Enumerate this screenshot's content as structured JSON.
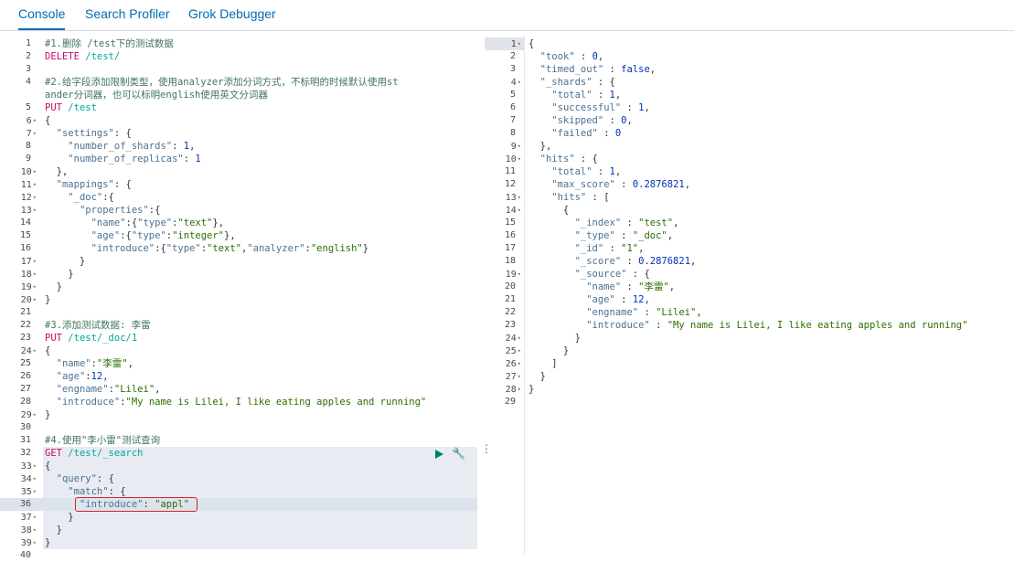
{
  "tabs": [
    {
      "label": "Console",
      "selected": true
    },
    {
      "label": "Search Profiler",
      "selected": false
    },
    {
      "label": "Grok Debugger",
      "selected": false
    }
  ],
  "request_lines": [
    {
      "n": "1",
      "t": [
        [
          "cmt",
          "#1.删除 /test下的测试数据"
        ]
      ]
    },
    {
      "n": "2",
      "t": [
        [
          "mth",
          "DELETE "
        ],
        [
          "url",
          "/test/"
        ]
      ]
    },
    {
      "n": "3",
      "t": []
    },
    {
      "n": "4",
      "t": [
        [
          "cmt",
          "#2.给字段添加限制类型，使用analyzer添加分词方式，不标明的时候默认使用st"
        ]
      ],
      "cont": [
        [
          "cmt",
          "ander分词器，也可以标明english使用英文分词器"
        ]
      ]
    },
    {
      "n": "5",
      "t": [
        [
          "mth",
          "PUT "
        ],
        [
          "url",
          "/test"
        ]
      ]
    },
    {
      "n": "6",
      "f": 1,
      "t": [
        [
          "pn",
          "{"
        ]
      ]
    },
    {
      "n": "7",
      "f": 1,
      "t": [
        [
          "pn",
          "  "
        ],
        [
          "key",
          "\"settings\""
        ],
        [
          "pn",
          ": {"
        ]
      ]
    },
    {
      "n": "8",
      "t": [
        [
          "pn",
          "    "
        ],
        [
          "key",
          "\"number_of_shards\""
        ],
        [
          "pn",
          ": "
        ],
        [
          "num",
          "1"
        ],
        [
          "pn",
          ","
        ]
      ]
    },
    {
      "n": "9",
      "t": [
        [
          "pn",
          "    "
        ],
        [
          "key",
          "\"number_of_replicas\""
        ],
        [
          "pn",
          ": "
        ],
        [
          "num",
          "1"
        ]
      ]
    },
    {
      "n": "10",
      "f": 1,
      "t": [
        [
          "pn",
          "  },"
        ]
      ]
    },
    {
      "n": "11",
      "f": 1,
      "t": [
        [
          "pn",
          "  "
        ],
        [
          "key",
          "\"mappings\""
        ],
        [
          "pn",
          ": {"
        ]
      ]
    },
    {
      "n": "12",
      "f": 1,
      "t": [
        [
          "pn",
          "    "
        ],
        [
          "key",
          "\"_doc\""
        ],
        [
          "pn",
          ":{"
        ]
      ]
    },
    {
      "n": "13",
      "f": 1,
      "t": [
        [
          "pn",
          "      "
        ],
        [
          "key",
          "\"properties\""
        ],
        [
          "pn",
          ":{"
        ]
      ]
    },
    {
      "n": "14",
      "t": [
        [
          "pn",
          "        "
        ],
        [
          "key",
          "\"name\""
        ],
        [
          "pn",
          ":{"
        ],
        [
          "key",
          "\"type\""
        ],
        [
          "pn",
          ":"
        ],
        [
          "str",
          "\"text\""
        ],
        [
          "pn",
          "},"
        ]
      ]
    },
    {
      "n": "15",
      "t": [
        [
          "pn",
          "        "
        ],
        [
          "key",
          "\"age\""
        ],
        [
          "pn",
          ":{"
        ],
        [
          "key",
          "\"type\""
        ],
        [
          "pn",
          ":"
        ],
        [
          "str",
          "\"integer\""
        ],
        [
          "pn",
          "},"
        ]
      ]
    },
    {
      "n": "16",
      "t": [
        [
          "pn",
          "        "
        ],
        [
          "key",
          "\"introduce\""
        ],
        [
          "pn",
          ":{"
        ],
        [
          "key",
          "\"type\""
        ],
        [
          "pn",
          ":"
        ],
        [
          "str",
          "\"text\""
        ],
        [
          "pn",
          ","
        ],
        [
          "key",
          "\"analyzer\""
        ],
        [
          "pn",
          ":"
        ],
        [
          "str",
          "\"english\""
        ],
        [
          "pn",
          "}"
        ]
      ]
    },
    {
      "n": "17",
      "f": 1,
      "t": [
        [
          "pn",
          "      }"
        ]
      ]
    },
    {
      "n": "18",
      "f": 1,
      "t": [
        [
          "pn",
          "    }"
        ]
      ]
    },
    {
      "n": "19",
      "f": 1,
      "t": [
        [
          "pn",
          "  }"
        ]
      ]
    },
    {
      "n": "20",
      "f": 1,
      "t": [
        [
          "pn",
          "}"
        ]
      ]
    },
    {
      "n": "21",
      "t": []
    },
    {
      "n": "22",
      "t": [
        [
          "cmt",
          "#3.添加测试数据: 李雷"
        ]
      ]
    },
    {
      "n": "23",
      "t": [
        [
          "mth",
          "PUT "
        ],
        [
          "url",
          "/test/_doc/1"
        ]
      ]
    },
    {
      "n": "24",
      "f": 1,
      "t": [
        [
          "pn",
          "{"
        ]
      ]
    },
    {
      "n": "25",
      "t": [
        [
          "pn",
          "  "
        ],
        [
          "key",
          "\"name\""
        ],
        [
          "pn",
          ":"
        ],
        [
          "str",
          "\"李雷\""
        ],
        [
          "pn",
          ","
        ]
      ]
    },
    {
      "n": "26",
      "t": [
        [
          "pn",
          "  "
        ],
        [
          "key",
          "\"age\""
        ],
        [
          "pn",
          ":"
        ],
        [
          "num",
          "12"
        ],
        [
          "pn",
          ","
        ]
      ]
    },
    {
      "n": "27",
      "t": [
        [
          "pn",
          "  "
        ],
        [
          "key",
          "\"engname\""
        ],
        [
          "pn",
          ":"
        ],
        [
          "str",
          "\"Lilei\""
        ],
        [
          "pn",
          ","
        ]
      ]
    },
    {
      "n": "28",
      "t": [
        [
          "pn",
          "  "
        ],
        [
          "key",
          "\"introduce\""
        ],
        [
          "pn",
          ":"
        ],
        [
          "str",
          "\"My name is Lilei, I like eating apples and running\""
        ]
      ]
    },
    {
      "n": "29",
      "f": 1,
      "t": [
        [
          "pn",
          "}"
        ]
      ]
    },
    {
      "n": "30",
      "t": []
    },
    {
      "n": "31",
      "t": [
        [
          "cmt",
          "#4.使用\"李小雷\"测试查询"
        ]
      ]
    },
    {
      "n": "32",
      "t": [
        [
          "mth",
          "GET "
        ],
        [
          "url",
          "/test/_search"
        ]
      ]
    },
    {
      "n": "33",
      "f": 1,
      "t": [
        [
          "pn",
          "{"
        ]
      ]
    },
    {
      "n": "34",
      "f": 1,
      "t": [
        [
          "pn",
          "  "
        ],
        [
          "key",
          "\"query\""
        ],
        [
          "pn",
          ": {"
        ]
      ]
    },
    {
      "n": "35",
      "f": 1,
      "t": [
        [
          "pn",
          "    "
        ],
        [
          "key",
          "\"match\""
        ],
        [
          "pn",
          ": {"
        ]
      ]
    },
    {
      "n": "36",
      "t": [
        [
          "pn",
          "      "
        ],
        [
          "key",
          "\"introduce\""
        ],
        [
          "pn",
          ": "
        ],
        [
          "str",
          "\"appl\""
        ]
      ]
    },
    {
      "n": "37",
      "f": 1,
      "t": [
        [
          "pn",
          "    }"
        ]
      ]
    },
    {
      "n": "38",
      "f": 1,
      "t": [
        [
          "pn",
          "  }"
        ]
      ]
    },
    {
      "n": "39",
      "f": 1,
      "t": [
        [
          "pn",
          "}"
        ]
      ]
    },
    {
      "n": "40",
      "t": []
    }
  ],
  "response_lines": [
    {
      "n": "1",
      "f": 1,
      "t": [
        [
          "pn",
          "{"
        ]
      ]
    },
    {
      "n": "2",
      "t": [
        [
          "pn",
          "  "
        ],
        [
          "key",
          "\"took\""
        ],
        [
          "pn",
          " : "
        ],
        [
          "num",
          "0"
        ],
        [
          "pn",
          ","
        ]
      ]
    },
    {
      "n": "3",
      "t": [
        [
          "pn",
          "  "
        ],
        [
          "key",
          "\"timed_out\""
        ],
        [
          "pn",
          " : "
        ],
        [
          "kw",
          "false"
        ],
        [
          "pn",
          ","
        ]
      ]
    },
    {
      "n": "4",
      "f": 1,
      "t": [
        [
          "pn",
          "  "
        ],
        [
          "key",
          "\"_shards\""
        ],
        [
          "pn",
          " : {"
        ]
      ]
    },
    {
      "n": "5",
      "t": [
        [
          "pn",
          "    "
        ],
        [
          "key",
          "\"total\""
        ],
        [
          "pn",
          " : "
        ],
        [
          "num",
          "1"
        ],
        [
          "pn",
          ","
        ]
      ]
    },
    {
      "n": "6",
      "t": [
        [
          "pn",
          "    "
        ],
        [
          "key",
          "\"successful\""
        ],
        [
          "pn",
          " : "
        ],
        [
          "num",
          "1"
        ],
        [
          "pn",
          ","
        ]
      ]
    },
    {
      "n": "7",
      "t": [
        [
          "pn",
          "    "
        ],
        [
          "key",
          "\"skipped\""
        ],
        [
          "pn",
          " : "
        ],
        [
          "num",
          "0"
        ],
        [
          "pn",
          ","
        ]
      ]
    },
    {
      "n": "8",
      "t": [
        [
          "pn",
          "    "
        ],
        [
          "key",
          "\"failed\""
        ],
        [
          "pn",
          " : "
        ],
        [
          "num",
          "0"
        ]
      ]
    },
    {
      "n": "9",
      "f": 1,
      "t": [
        [
          "pn",
          "  },"
        ]
      ]
    },
    {
      "n": "10",
      "f": 1,
      "t": [
        [
          "pn",
          "  "
        ],
        [
          "key",
          "\"hits\""
        ],
        [
          "pn",
          " : {"
        ]
      ]
    },
    {
      "n": "11",
      "t": [
        [
          "pn",
          "    "
        ],
        [
          "key",
          "\"total\""
        ],
        [
          "pn",
          " : "
        ],
        [
          "num",
          "1"
        ],
        [
          "pn",
          ","
        ]
      ]
    },
    {
      "n": "12",
      "t": [
        [
          "pn",
          "    "
        ],
        [
          "key",
          "\"max_score\""
        ],
        [
          "pn",
          " : "
        ],
        [
          "num",
          "0.2876821"
        ],
        [
          "pn",
          ","
        ]
      ]
    },
    {
      "n": "13",
      "f": 1,
      "t": [
        [
          "pn",
          "    "
        ],
        [
          "key",
          "\"hits\""
        ],
        [
          "pn",
          " : ["
        ]
      ]
    },
    {
      "n": "14",
      "f": 1,
      "t": [
        [
          "pn",
          "      {"
        ]
      ]
    },
    {
      "n": "15",
      "t": [
        [
          "pn",
          "        "
        ],
        [
          "key",
          "\"_index\""
        ],
        [
          "pn",
          " : "
        ],
        [
          "str",
          "\"test\""
        ],
        [
          "pn",
          ","
        ]
      ]
    },
    {
      "n": "16",
      "t": [
        [
          "pn",
          "        "
        ],
        [
          "key",
          "\"_type\""
        ],
        [
          "pn",
          " : "
        ],
        [
          "str",
          "\"_doc\""
        ],
        [
          "pn",
          ","
        ]
      ]
    },
    {
      "n": "17",
      "t": [
        [
          "pn",
          "        "
        ],
        [
          "key",
          "\"_id\""
        ],
        [
          "pn",
          " : "
        ],
        [
          "str",
          "\"1\""
        ],
        [
          "pn",
          ","
        ]
      ]
    },
    {
      "n": "18",
      "t": [
        [
          "pn",
          "        "
        ],
        [
          "key",
          "\"_score\""
        ],
        [
          "pn",
          " : "
        ],
        [
          "num",
          "0.2876821"
        ],
        [
          "pn",
          ","
        ]
      ]
    },
    {
      "n": "19",
      "f": 1,
      "t": [
        [
          "pn",
          "        "
        ],
        [
          "key",
          "\"_source\""
        ],
        [
          "pn",
          " : {"
        ]
      ]
    },
    {
      "n": "20",
      "t": [
        [
          "pn",
          "          "
        ],
        [
          "key",
          "\"name\""
        ],
        [
          "pn",
          " : "
        ],
        [
          "str",
          "\"李雷\""
        ],
        [
          "pn",
          ","
        ]
      ]
    },
    {
      "n": "21",
      "t": [
        [
          "pn",
          "          "
        ],
        [
          "key",
          "\"age\""
        ],
        [
          "pn",
          " : "
        ],
        [
          "num",
          "12"
        ],
        [
          "pn",
          ","
        ]
      ]
    },
    {
      "n": "22",
      "t": [
        [
          "pn",
          "          "
        ],
        [
          "key",
          "\"engname\""
        ],
        [
          "pn",
          " : "
        ],
        [
          "str",
          "\"Lilei\""
        ],
        [
          "pn",
          ","
        ]
      ]
    },
    {
      "n": "23",
      "t": [
        [
          "pn",
          "          "
        ],
        [
          "key",
          "\"introduce\""
        ],
        [
          "pn",
          " : "
        ],
        [
          "str",
          "\"My name is Lilei, I like eating apples and running\""
        ]
      ]
    },
    {
      "n": "24",
      "f": 1,
      "t": [
        [
          "pn",
          "        }"
        ]
      ]
    },
    {
      "n": "25",
      "f": 1,
      "t": [
        [
          "pn",
          "      }"
        ]
      ]
    },
    {
      "n": "26",
      "f": 1,
      "t": [
        [
          "pn",
          "    ]"
        ]
      ]
    },
    {
      "n": "27",
      "f": 1,
      "t": [
        [
          "pn",
          "  }"
        ]
      ]
    },
    {
      "n": "28",
      "f": 1,
      "t": [
        [
          "pn",
          "}"
        ]
      ]
    },
    {
      "n": "29",
      "t": []
    }
  ],
  "icons": {
    "run": "play-icon",
    "settings": "wrench-icon",
    "menu": "vertical-dots-icon"
  },
  "colors": {
    "accent": "#006bb4",
    "run": "#017d73",
    "highlight_box": "#d6222a"
  }
}
